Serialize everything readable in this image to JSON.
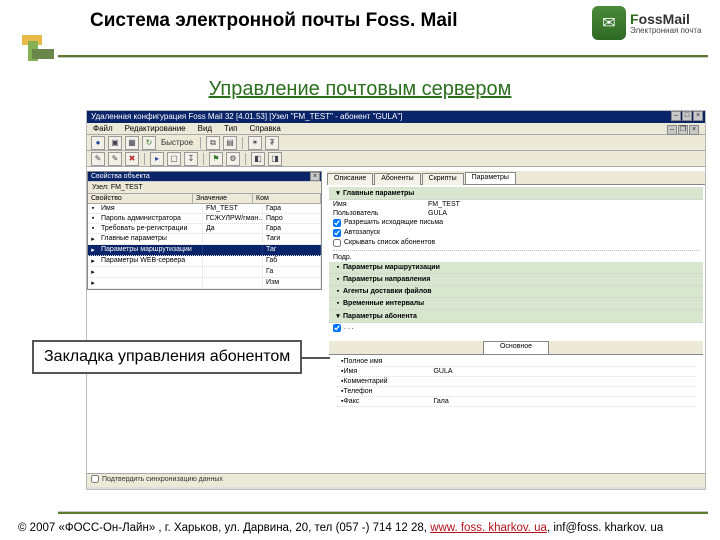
{
  "header": {
    "title": "Система электронной почты Foss. Mail",
    "logo_main": "F",
    "logo_rest": "ossMail",
    "logo_sub": "Электронная почта"
  },
  "subtitle": "Управление почтовым сервером",
  "app": {
    "titlebar": "Удаленная конфигурация Foss Mail 32 [4.01.53]   [Узел \"FM_TEST\" - абонент \"GULA\"]",
    "menu": [
      "Файл",
      "Редактирование",
      "Вид",
      "Тип",
      "Справка"
    ],
    "toolbar_label": "Быстрое"
  },
  "props_panel": {
    "title": "Свойства объекта",
    "subtitle": "Узел: FM_TEST",
    "columns": {
      "c1": "Свойство",
      "c2": "Значение",
      "c3": "Ком"
    },
    "rows": [
      {
        "p": "Имя",
        "v": "FM_TEST",
        "cm": "Гара"
      },
      {
        "p": "Пароль администратора",
        "v": "ГСЖУЛРW/гман...",
        "cm": "Паро"
      },
      {
        "p": "Требовать ре-регистрации",
        "v": "Да",
        "cm": "Гара"
      },
      {
        "p": "Главные параметры",
        "v": "",
        "cm": "Таги"
      },
      {
        "p": "Параметры маршрутизации",
        "v": "",
        "cm": "Таг",
        "sel": true
      },
      {
        "p": "Параметры WEB-сервера",
        "v": "",
        "cm": "Габ"
      },
      {
        "p": "",
        "v": "",
        "cm": "Га "
      },
      {
        "p": "",
        "v": "",
        "cm": "Изм"
      }
    ]
  },
  "right": {
    "tabs": [
      "Описание",
      "Абоненты",
      "Скрипты",
      "Параметры"
    ],
    "section_main": "Главные параметры",
    "fields": {
      "node": {
        "k": "Имя",
        "v": "FM_TEST"
      },
      "user": {
        "k": "Пользователь",
        "v": "GULA"
      },
      "cb1": "Разрешить исходящие письма",
      "cb2": "Автозапуск",
      "cb3": "Скрывать список абонентов"
    },
    "more_label": "Подр.",
    "sections": [
      "Параметры маршрутизации",
      "Параметры направления",
      "Агенты доставки файлов",
      "Временные интервалы",
      "Параметры абонента"
    ],
    "inner_tab": "Основное",
    "flist": [
      {
        "k": "Полное имя",
        "v": ""
      },
      {
        "k": "Имя",
        "v": "GULA"
      },
      {
        "k": "Комментарий",
        "v": ""
      },
      {
        "k": "Телефон",
        "v": ""
      },
      {
        "k": "Факс",
        "v": "Гала"
      }
    ],
    "bottom_checkbox": "Подтвердить синхронизацию данных"
  },
  "callout": "Закладка управления абонентом",
  "footer": {
    "pre": "© 2007 «ФОСС-Он-Лайн» , г. Харьков, ул. Дарвина, 20, тел (057 -) 714 12 28, ",
    "link": "www. foss. kharkov. ua",
    "post": ", inf@foss. kharkov. ua"
  }
}
